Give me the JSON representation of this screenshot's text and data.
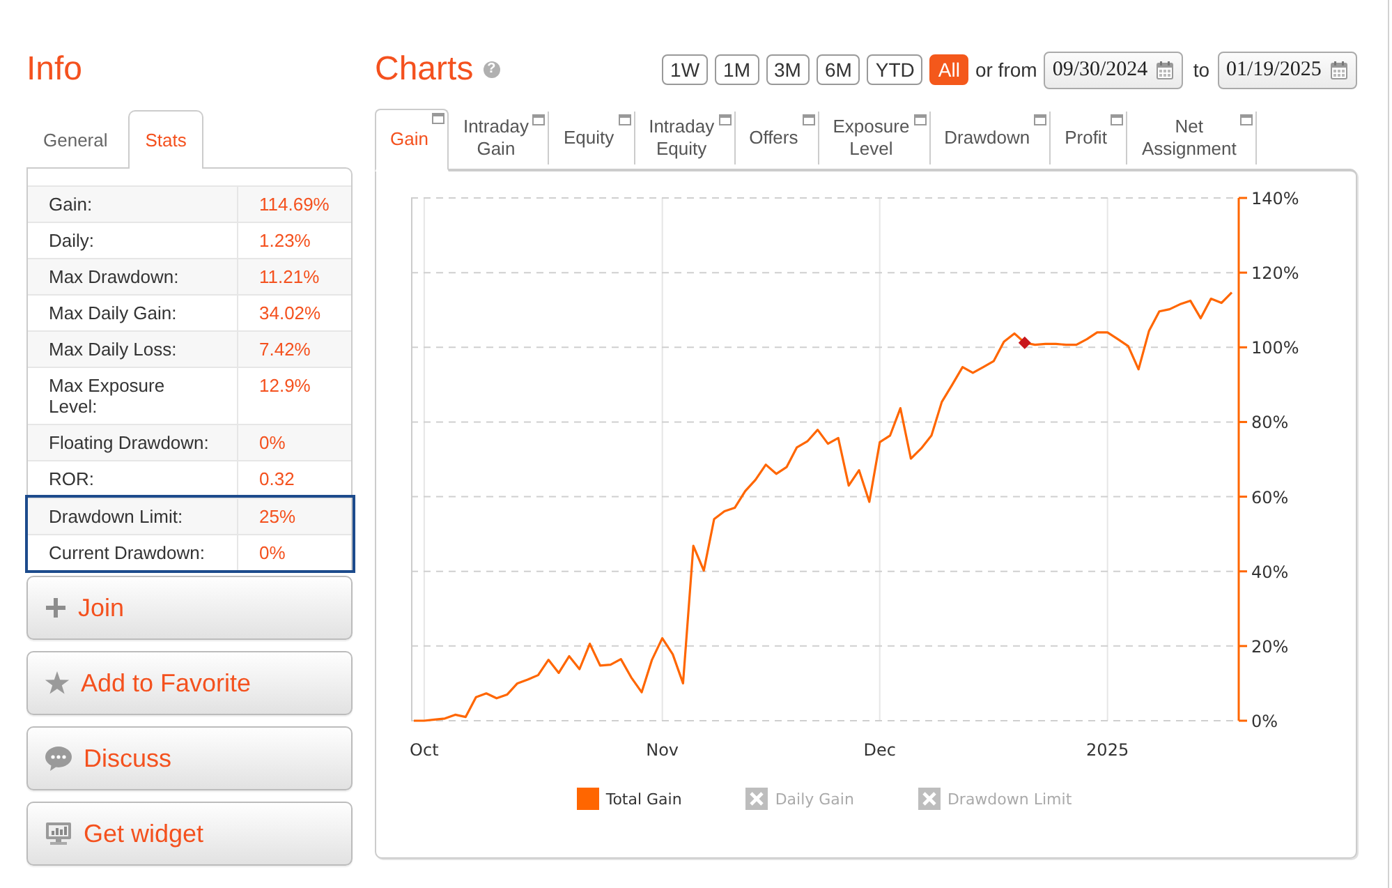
{
  "info": {
    "title": "Info",
    "tabs": [
      {
        "label": "General",
        "selected": false
      },
      {
        "label": "Stats",
        "selected": true
      }
    ],
    "stats": [
      {
        "label": "Gain:",
        "value": "114.69%",
        "highlighted": false
      },
      {
        "label": "Daily:",
        "value": "1.23%",
        "highlighted": false
      },
      {
        "label": "Max Drawdown:",
        "value": "11.21%",
        "highlighted": false
      },
      {
        "label": "Max Daily Gain:",
        "value": "34.02%",
        "highlighted": false
      },
      {
        "label": "Max Daily Loss:",
        "value": "7.42%",
        "highlighted": false
      },
      {
        "label": "Max Exposure Level:",
        "value": "12.9%",
        "highlighted": false
      },
      {
        "label": "Floating Drawdown:",
        "value": "0%",
        "highlighted": false
      },
      {
        "label": "ROR:",
        "value": "0.32",
        "highlighted": false
      },
      {
        "label": "Drawdown Limit:",
        "value": "25%",
        "highlighted": true
      },
      {
        "label": "Current Drawdown:",
        "value": "0%",
        "highlighted": true
      }
    ],
    "actions": [
      {
        "kind": "join",
        "label": "Join"
      },
      {
        "kind": "favorite",
        "label": "Add to Favorite"
      },
      {
        "kind": "discuss",
        "label": "Discuss"
      },
      {
        "kind": "widget",
        "label": "Get widget"
      }
    ]
  },
  "charts": {
    "title": "Charts",
    "help": "?",
    "ranges": [
      {
        "label": "1W",
        "selected": false
      },
      {
        "label": "1M",
        "selected": false
      },
      {
        "label": "3M",
        "selected": false
      },
      {
        "label": "6M",
        "selected": false
      },
      {
        "label": "YTD",
        "selected": false
      },
      {
        "label": "All",
        "selected": true
      }
    ],
    "from_label": "or from",
    "date_from": {
      "value": "09/30/2024"
    },
    "to_label": "to",
    "date_to": {
      "value": "01/19/2025"
    },
    "tabs": [
      {
        "label": "Gain",
        "selected": true
      },
      {
        "label": "Intraday Gain",
        "selected": false
      },
      {
        "label": "Equity",
        "selected": false
      },
      {
        "label": "Intraday Equity",
        "selected": false
      },
      {
        "label": "Offers",
        "selected": false
      },
      {
        "label": "Exposure Level",
        "selected": false
      },
      {
        "label": "Drawdown",
        "selected": false
      },
      {
        "label": "Profit",
        "selected": false
      },
      {
        "label": "Net Assignment",
        "selected": false
      }
    ],
    "chart_data": {
      "type": "line",
      "grid": true,
      "categories": [
        null,
        "Oct",
        null,
        null,
        null,
        null,
        null,
        null,
        null,
        null,
        null,
        null,
        null,
        null,
        null,
        null,
        null,
        null,
        null,
        null,
        null,
        null,
        null,
        null,
        "Nov",
        null,
        null,
        null,
        null,
        null,
        null,
        null,
        null,
        null,
        null,
        null,
        null,
        null,
        null,
        null,
        null,
        null,
        null,
        null,
        null,
        "Dec",
        null,
        null,
        null,
        null,
        null,
        null,
        null,
        null,
        null,
        null,
        null,
        null,
        null,
        null,
        null,
        null,
        null,
        null,
        null,
        null,
        null,
        "2025",
        null,
        null,
        null,
        null,
        null,
        null,
        null,
        null,
        null,
        null,
        null,
        null
      ],
      "series": [
        {
          "color": "#ff6600",
          "values": [
            0,
            0,
            0.3,
            0.6,
            1.6,
            1.0,
            6.3,
            7.3,
            6.0,
            7.0,
            10.0,
            11.0,
            12.2,
            16.3,
            12.8,
            17.3,
            13.8,
            20.6,
            14.8,
            15.0,
            16.5,
            11.6,
            7.6,
            16.3,
            22.1,
            17.8,
            10.0,
            46.8,
            40.2,
            54.0,
            56.1,
            57.0,
            61.5,
            64.5,
            68.6,
            66.1,
            67.9,
            73.2,
            74.8,
            77.9,
            74.2,
            75.7,
            63.0,
            67.1,
            58.6,
            74.6,
            76.4,
            83.7,
            70.2,
            72.9,
            76.4,
            85.4,
            90.0,
            94.7,
            93.2,
            94.7,
            96.3,
            101.5,
            103.7,
            101.2,
            100.7,
            100.9,
            100.9,
            100.7,
            100.7,
            102.2,
            104.0,
            104.0,
            102.2,
            100.3,
            94.1,
            104.4,
            109.6,
            110.2,
            111.5,
            112.5,
            107.8,
            113.0,
            111.9,
            114.7
          ]
        },
        {
          "color": "#c8161d",
          "marker": "diamond",
          "values": [
            null,
            null,
            null,
            null,
            null,
            null,
            null,
            null,
            null,
            null,
            null,
            null,
            null,
            null,
            null,
            null,
            null,
            null,
            null,
            null,
            null,
            null,
            null,
            null,
            null,
            null,
            null,
            null,
            null,
            null,
            null,
            null,
            null,
            null,
            null,
            null,
            null,
            null,
            null,
            null,
            null,
            null,
            null,
            null,
            null,
            null,
            null,
            null,
            null,
            null,
            null,
            null,
            null,
            null,
            null,
            null,
            null,
            null,
            null,
            101.2,
            null,
            null,
            null,
            null,
            null,
            null,
            null,
            null,
            null,
            null,
            null,
            null,
            null,
            null,
            null,
            null,
            null,
            null,
            null,
            null
          ]
        }
      ],
      "ylim": [
        0,
        140
      ],
      "yticks": [
        {
          "value": 0,
          "label": "0%"
        },
        {
          "value": 20,
          "label": "20%"
        },
        {
          "value": 40,
          "label": "40%"
        },
        {
          "value": 60,
          "label": "60%"
        },
        {
          "value": 80,
          "label": "80%"
        },
        {
          "value": 100,
          "label": "100%"
        },
        {
          "value": 120,
          "label": "120%"
        },
        {
          "value": 140,
          "label": "140%"
        }
      ]
    },
    "legend": [
      {
        "label": "Total Gain",
        "visible": true,
        "color": "#ff6600"
      },
      {
        "label": "Daily Gain",
        "visible": false
      },
      {
        "label": "Drawdown Limit",
        "visible": false
      }
    ]
  }
}
